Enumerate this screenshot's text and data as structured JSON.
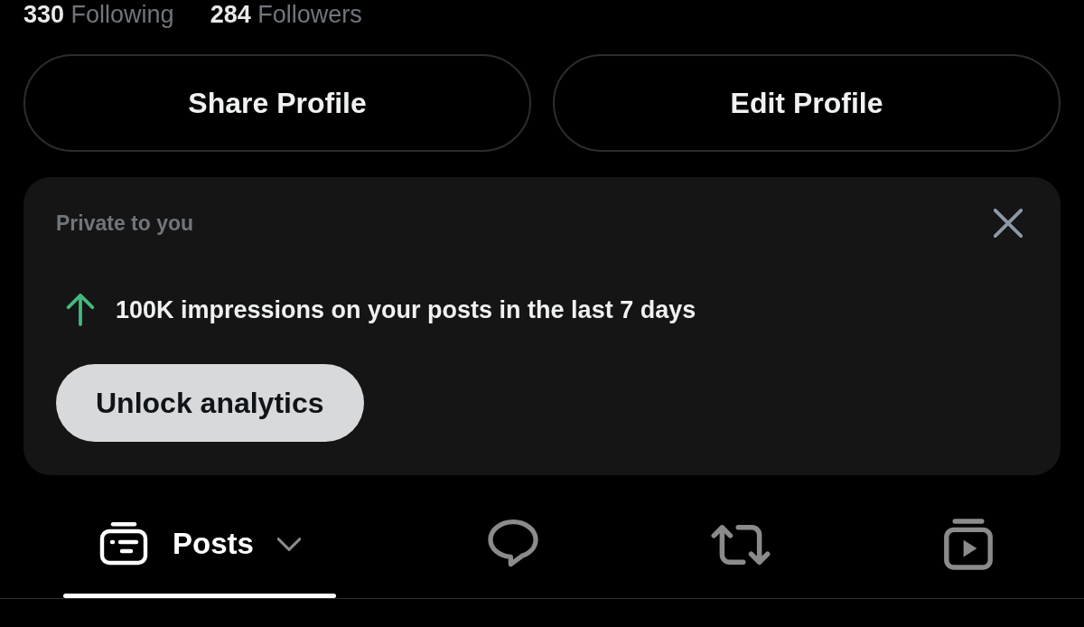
{
  "profile_stats": [
    {
      "count": "330",
      "label": "Following"
    },
    {
      "count": "284",
      "label": "Followers"
    }
  ],
  "profile_buttons": [
    "Share Profile",
    "Edit Profile"
  ],
  "insight_card": {
    "caption": "Private to you",
    "trend_up": true,
    "message": "100K impressions on your posts in the last 7 days",
    "action": "Unlock analytics"
  },
  "tabs": [
    {
      "kind": "posts",
      "label": "Posts",
      "dropdown": true,
      "selected": true
    },
    {
      "kind": "bubble",
      "dropdown": false,
      "selected": false
    },
    {
      "kind": "repost",
      "dropdown": false,
      "selected": false
    },
    {
      "kind": "play",
      "dropdown": false,
      "selected": false
    }
  ]
}
